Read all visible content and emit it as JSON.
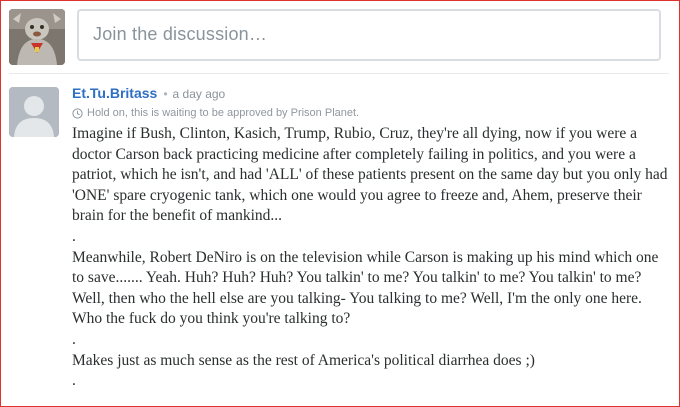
{
  "composer": {
    "placeholder": "Join the discussion…"
  },
  "comment": {
    "author": "Et.Tu.Britass",
    "separator": "•",
    "time": "a day ago",
    "pending_icon": "clock-icon",
    "pending_text": "Hold on, this is waiting to be approved by Prison Planet.",
    "paragraphs": [
      "Imagine if Bush, Clinton, Kasich, Trump, Rubio, Cruz, they're all dying, now if you were a doctor Carson back practicing medicine after completely failing in politics, and you were a patriot, which he isn't, and had 'ALL' of these patients present on the same day but you only had 'ONE' spare cryogenic tank, which one would you agree to freeze and, Ahem, preserve their brain for the benefit of mankind...",
      ".",
      "Meanwhile, Robert DeNiro is on the television while Carson is making up his mind which one to save....... Yeah. Huh? Huh? Huh? You talkin' to me? You talkin' to me? You talkin' to me? Well, then who the hell else are you talking- You talking to me? Well, I'm the only one here. Who the fuck do you think you're talking to?",
      ".",
      "Makes just as much sense as the rest of America's political diarrhea does ;)",
      "."
    ]
  },
  "colors": {
    "author_link": "#2e6fc3",
    "frame_border": "#e0322d",
    "placeholder_text": "#8a939b",
    "body_text": "#2a2e2e"
  }
}
